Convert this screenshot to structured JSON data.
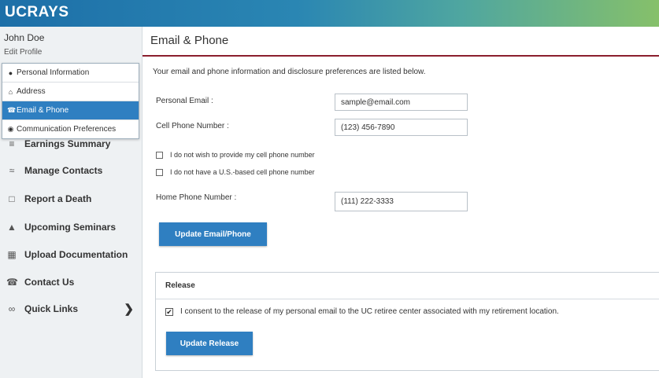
{
  "app": {
    "brand": "UCRAYS"
  },
  "sidebar": {
    "user_name": "John Doe",
    "edit_profile": "Edit Profile",
    "submenu": [
      {
        "label": "Personal Information",
        "icon": "person-icon"
      },
      {
        "label": "Address",
        "icon": "home-icon"
      },
      {
        "label": "Email & Phone",
        "icon": "phone-icon",
        "active": true
      },
      {
        "label": "Communication Preferences",
        "icon": "chat-icon"
      }
    ],
    "nav": [
      {
        "label": "Earnings Summary",
        "icon": "coins-icon"
      },
      {
        "label": "Manage Contacts",
        "icon": "contacts-icon"
      },
      {
        "label": "Report a Death",
        "icon": "document-icon"
      },
      {
        "label": "Upcoming Seminars",
        "icon": "seminar-icon"
      },
      {
        "label": "Upload Documentation",
        "icon": "upload-icon"
      },
      {
        "label": "Contact Us",
        "icon": "phone-icon"
      },
      {
        "label": "Quick Links",
        "icon": "link-icon"
      }
    ]
  },
  "main": {
    "title": "Email & Phone",
    "intro": "Your email and phone information and disclosure preferences are listed below.",
    "personal_email_label": "Personal Email :",
    "personal_email_value": "sample@email.com",
    "cell_phone_label": "Cell Phone Number :",
    "cell_phone_value": "(123) 456-7890",
    "no_cell_label": "I do not wish to provide my cell phone number",
    "no_cell_checked": false,
    "no_us_cell_label": "I do not have a U.S.-based cell phone number",
    "no_us_cell_checked": false,
    "home_phone_label": "Home Phone Number :",
    "home_phone_value": "(111) 222-3333",
    "update_button": "Update Email/Phone"
  },
  "release": {
    "title": "Release",
    "consent_label": "I consent to the release of my personal email to the UC retiree center associated with my retirement location.",
    "consent_checked": true,
    "button": "Update Release"
  },
  "colors": {
    "accent_blue": "#2f7fc1",
    "title_rule": "#8b1e2d",
    "sidebar_bg": "#eef1f3"
  }
}
